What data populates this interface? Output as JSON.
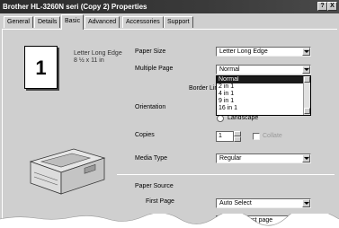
{
  "window": {
    "title": "Brother HL-3260N seri (Copy 2) Properties"
  },
  "titlebar_buttons": {
    "help": "?",
    "close": "X"
  },
  "tabs": [
    {
      "label": "General"
    },
    {
      "label": "Details"
    },
    {
      "label": "Basic"
    },
    {
      "label": "Advanced"
    },
    {
      "label": "Accessories"
    },
    {
      "label": "Support"
    }
  ],
  "preview": {
    "number": "1",
    "paper_name": "Letter Long Edge",
    "paper_dims": "8 ½ x 11 in"
  },
  "paper_size": {
    "label": "Paper Size",
    "value": "Letter Long Edge"
  },
  "multiple_page": {
    "label": "Multiple Page",
    "value": "Normal",
    "options": [
      "Normal",
      "2 in 1",
      "4 in 1",
      "9 in 1",
      "16 in 1"
    ]
  },
  "border_line": {
    "label": "Border Lin"
  },
  "orientation": {
    "label": "Orientation",
    "landscape_label": "Landscape"
  },
  "copies": {
    "label": "Copies",
    "value": "1",
    "collate_label": "Collate"
  },
  "media_type": {
    "label": "Media Type",
    "value": "Regular"
  },
  "paper_source": {
    "heading": "Paper Source",
    "first_page_label": "First Page",
    "first_page_value": "Auto Select",
    "other_pages_value": "Same to First page"
  }
}
